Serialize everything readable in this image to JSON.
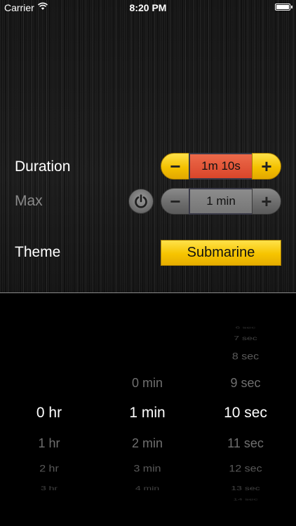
{
  "status_bar": {
    "carrier": "Carrier",
    "time": "8:20 PM"
  },
  "settings": {
    "duration": {
      "label": "Duration",
      "value": "1m 10s",
      "minus": "−",
      "plus": "+"
    },
    "max": {
      "label": "Max",
      "value": "1 min",
      "minus": "−",
      "plus": "+",
      "enabled": false
    },
    "theme": {
      "label": "Theme",
      "value": "Submarine"
    }
  },
  "picker": {
    "hours": {
      "selected": "0 hr",
      "below": [
        "1 hr",
        "2 hr",
        "3 hr"
      ]
    },
    "minutes": {
      "above": [
        "0 min"
      ],
      "selected": "1 min",
      "below": [
        "2 min",
        "3 min",
        "4 min"
      ]
    },
    "seconds": {
      "above": [
        "6 sec",
        "7 sec",
        "8 sec",
        "9 sec"
      ],
      "selected": "10 sec",
      "below": [
        "11 sec",
        "12 sec",
        "13 sec",
        "14 sec"
      ]
    }
  },
  "colors": {
    "accent_yellow": "#f4c100",
    "duration_value_bg": "#e0543a",
    "disabled_gray": "#767676"
  }
}
